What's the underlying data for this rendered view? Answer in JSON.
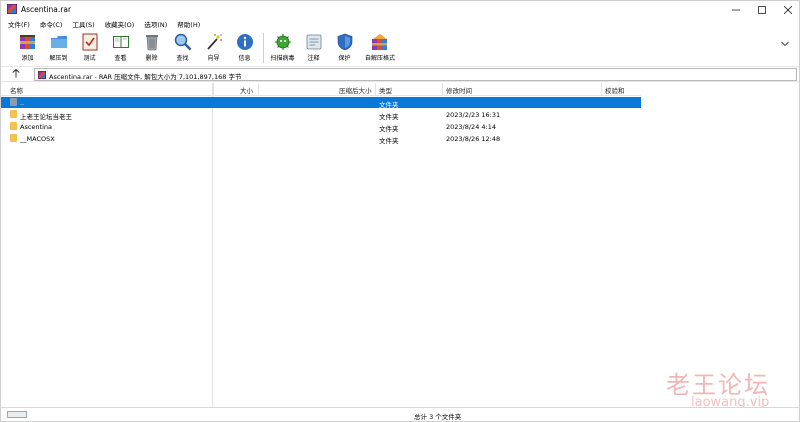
{
  "window": {
    "title": "Ascentina.rar"
  },
  "menu": {
    "items": [
      "文件(F)",
      "命令(C)",
      "工具(S)",
      "收藏夹(O)",
      "选项(N)",
      "帮助(H)"
    ]
  },
  "toolbar": {
    "buttons": [
      {
        "label": "添加",
        "icon": "add-archive-icon"
      },
      {
        "label": "解压到",
        "icon": "extract-to-icon"
      },
      {
        "label": "测试",
        "icon": "test-icon"
      },
      {
        "label": "查看",
        "icon": "view-book-icon"
      },
      {
        "label": "删除",
        "icon": "trash-icon"
      },
      {
        "label": "查找",
        "icon": "magnifier-icon"
      },
      {
        "label": "向导",
        "icon": "wizard-wand-icon"
      },
      {
        "label": "信息",
        "icon": "info-icon"
      },
      {
        "label": "扫描病毒",
        "icon": "virus-scan-icon"
      },
      {
        "label": "注释",
        "icon": "comment-icon"
      },
      {
        "label": "保护",
        "icon": "shield-icon"
      },
      {
        "label": "自解压格式",
        "icon": "sfx-archive-icon"
      }
    ]
  },
  "address": {
    "text": "Ascentina.rar - RAR 压缩文件, 解包大小为 7,101,897,168 字节"
  },
  "list": {
    "columns": [
      "名称",
      "大小",
      "压缩后大小",
      "类型",
      "修改时间",
      "校验和"
    ],
    "rows": [
      {
        "name": "..",
        "size": "",
        "packed": "",
        "type": "文件夹",
        "modified": "",
        "crc": ""
      },
      {
        "name": "上老王论坛当老王",
        "size": "",
        "packed": "",
        "type": "文件夹",
        "modified": "2023/2/23 16:31",
        "crc": ""
      },
      {
        "name": "Ascentina",
        "size": "",
        "packed": "",
        "type": "文件夹",
        "modified": "2023/8/24 4:14",
        "crc": ""
      },
      {
        "name": "__MACOSX",
        "size": "",
        "packed": "",
        "type": "文件夹",
        "modified": "2023/8/26 12:48",
        "crc": ""
      }
    ]
  },
  "status": {
    "text": "总计 3 个文件夹"
  },
  "watermark": {
    "line1": "老王论坛",
    "line2": "laowang.vip"
  },
  "colors": {
    "selection": "#0a78d7",
    "folder": "#f2c14e"
  }
}
